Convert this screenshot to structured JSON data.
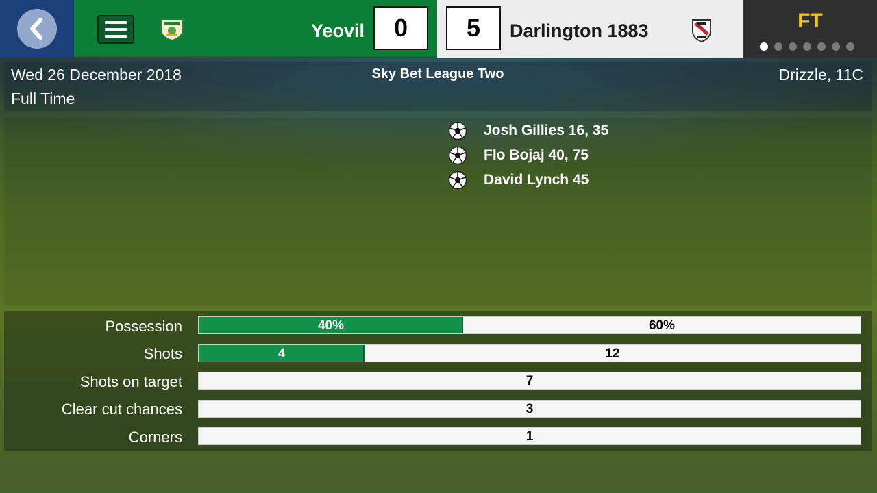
{
  "match": {
    "home_team": "Yeovil",
    "home_score": "0",
    "away_team": "Darlington 1883",
    "away_score": "5",
    "status_badge": "FT",
    "page_dots": 7,
    "active_dot": 0
  },
  "info": {
    "date": "Wed 26 December 2018",
    "status": "Full Time",
    "league": "Sky Bet League Two",
    "weather": "Drizzle, 11C"
  },
  "scorers": [
    {
      "name": "Josh Gillies 16, 35"
    },
    {
      "name": "Flo Bojaj 40, 75"
    },
    {
      "name": "David Lynch 45"
    }
  ],
  "stats": [
    {
      "label": "Possession",
      "home": "40%",
      "away": "60%",
      "home_fraction": 0.4
    },
    {
      "label": "Shots",
      "home": "4",
      "away": "12",
      "home_fraction": 0.25
    },
    {
      "label": "Shots on target",
      "home": "",
      "away": "",
      "single": "7"
    },
    {
      "label": "Clear cut chances",
      "home": "",
      "away": "",
      "single": "3"
    },
    {
      "label": "Corners",
      "home": "",
      "away": "",
      "single": "1"
    }
  ],
  "colors": {
    "home_primary": "#0b7f35",
    "away_primary": "#ededed",
    "ft_accent": "#f2c21b",
    "back_button": "#1c3f79"
  },
  "icons": {
    "back": "chevron-left-icon",
    "menu": "hamburger-menu-icon",
    "home_badge": "yeovil-crest-icon",
    "away_badge": "darlington-crest-icon",
    "goal": "football-icon"
  }
}
